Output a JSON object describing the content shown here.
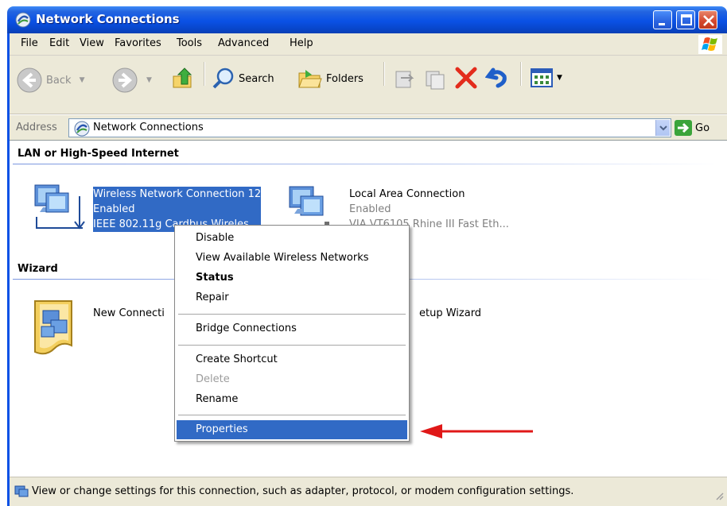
{
  "window": {
    "title": "Network Connections"
  },
  "menubar": {
    "items": [
      "File",
      "Edit",
      "View",
      "Favorites",
      "Tools",
      "Advanced",
      "Help"
    ]
  },
  "toolbar": {
    "back_label": "Back",
    "search_label": "Search",
    "folders_label": "Folders"
  },
  "address": {
    "label": "Address",
    "value": "Network Connections",
    "go_label": "Go"
  },
  "groups": {
    "lan_header": "LAN or High-Speed Internet",
    "wizard_header": "Wizard"
  },
  "connections": [
    {
      "name": "Wireless Network Connection 12",
      "status": "Enabled",
      "device": "IEEE 802.11g Cardbus Wireles..."
    },
    {
      "name": "Local Area Connection",
      "status": "Enabled",
      "device": "VIA VT6105 Rhine III Fast Eth..."
    }
  ],
  "wizard": {
    "name_left": "New Connecti",
    "name_right": "etup Wizard"
  },
  "context_menu": {
    "items": [
      {
        "label": "Disable"
      },
      {
        "label": "View Available Wireless Networks"
      },
      {
        "label": "Status"
      },
      {
        "label": "Repair"
      },
      {
        "label": "Bridge Connections"
      },
      {
        "label": "Create Shortcut"
      },
      {
        "label": "Delete"
      },
      {
        "label": "Rename"
      },
      {
        "label": "Properties"
      }
    ]
  },
  "statusbar": {
    "text": "View or change settings for this connection, such as adapter, protocol, or modem configuration settings."
  },
  "colors": {
    "titlebar": "#0a51e5",
    "selection": "#316ac5",
    "arrow": "#e01818"
  }
}
